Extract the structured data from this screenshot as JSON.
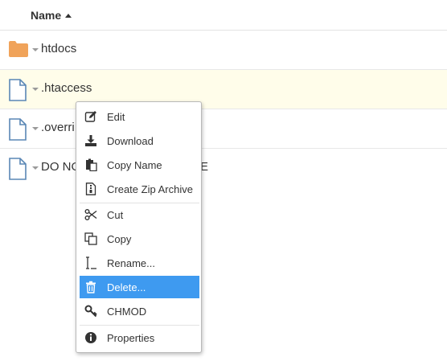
{
  "header": {
    "name_column": "Name"
  },
  "files": [
    {
      "name": "htdocs",
      "icon": "folder-icon"
    },
    {
      "name": ".htaccess",
      "icon": "file-icon"
    },
    {
      "name": ".overri",
      "icon": "file-icon"
    },
    {
      "name": "DO NO",
      "name_tail": "E",
      "icon": "file-icon"
    }
  ],
  "context_menu": {
    "items": [
      {
        "label": "Edit",
        "icon": "edit-icon"
      },
      {
        "label": "Download",
        "icon": "download-icon"
      },
      {
        "label": "Copy Name",
        "icon": "clipboard-icon"
      },
      {
        "label": "Create Zip Archive",
        "icon": "zip-icon"
      },
      {
        "label": "Cut",
        "icon": "scissors-icon"
      },
      {
        "label": "Copy",
        "icon": "copy-icon"
      },
      {
        "label": "Rename...",
        "icon": "cursor-icon"
      },
      {
        "label": "Delete...",
        "icon": "trash-icon"
      },
      {
        "label": "CHMOD",
        "icon": "key-icon"
      },
      {
        "label": "Properties",
        "icon": "info-icon"
      }
    ]
  },
  "colors": {
    "highlight": "#3e9af0",
    "folder": "#f0a35a",
    "file_icon": "#5a87b5",
    "selected_row": "#fffdea"
  }
}
